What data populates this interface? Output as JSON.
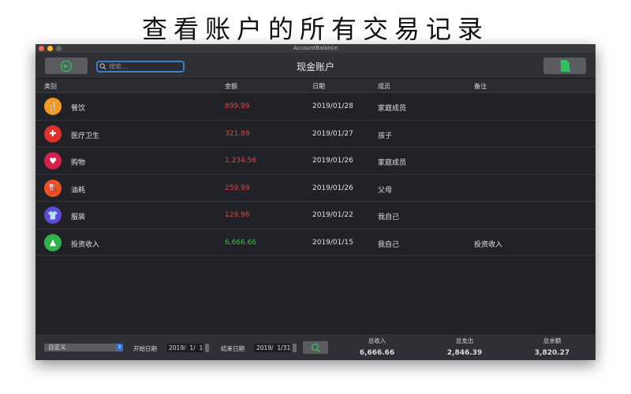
{
  "headline": "查看账户的所有交易记录",
  "window": {
    "title": "AccountBalance"
  },
  "toolbar": {
    "search_placeholder": "搜索...",
    "title": "现金账户"
  },
  "columns": [
    "类别",
    "金额",
    "日期",
    "成员",
    "备注"
  ],
  "rows": [
    {
      "category": "餐饮",
      "icon": "fork-knife-icon",
      "color": "#f39c1e",
      "amount": "899.99",
      "date": "2019/01/28",
      "member": "家庭成员",
      "note": ""
    },
    {
      "category": "医疗卫生",
      "icon": "first-aid-icon",
      "color": "#e0302c",
      "amount": "321.89",
      "date": "2019/01/27",
      "member": "孩子",
      "note": ""
    },
    {
      "category": "购物",
      "icon": "shopping-bag-icon",
      "color": "#d81f4e",
      "amount": "1,234.56",
      "date": "2019/01/26",
      "member": "家庭成员",
      "note": ""
    },
    {
      "category": "油耗",
      "icon": "fuel-pump-icon",
      "color": "#f0521e",
      "amount": "259.99",
      "date": "2019/01/26",
      "member": "父母",
      "note": ""
    },
    {
      "category": "服装",
      "icon": "tshirt-icon",
      "color": "#5d4bd8",
      "amount": "129.96",
      "date": "2019/01/22",
      "member": "我自己",
      "note": ""
    },
    {
      "category": "投资收入",
      "icon": "chart-up-icon",
      "color": "#2fb24c",
      "amount": "6,666.66",
      "date": "2019/01/15",
      "member": "我自己",
      "note": "投资收入",
      "income": true
    }
  ],
  "colors": {
    "expense": "#e8413c",
    "income": "#3fbf4a"
  },
  "footer": {
    "period": "自定义",
    "start_label": "开始日期",
    "start_date": "2019/  1/  1",
    "end_label": "结束日期",
    "end_date": "2019/  1/31",
    "total_income_label": "总收入",
    "total_income": "6,666.66",
    "total_expense_label": "总支出",
    "total_expense": "2,846.39",
    "total_balance_label": "总余额",
    "total_balance": "3,820.27"
  }
}
